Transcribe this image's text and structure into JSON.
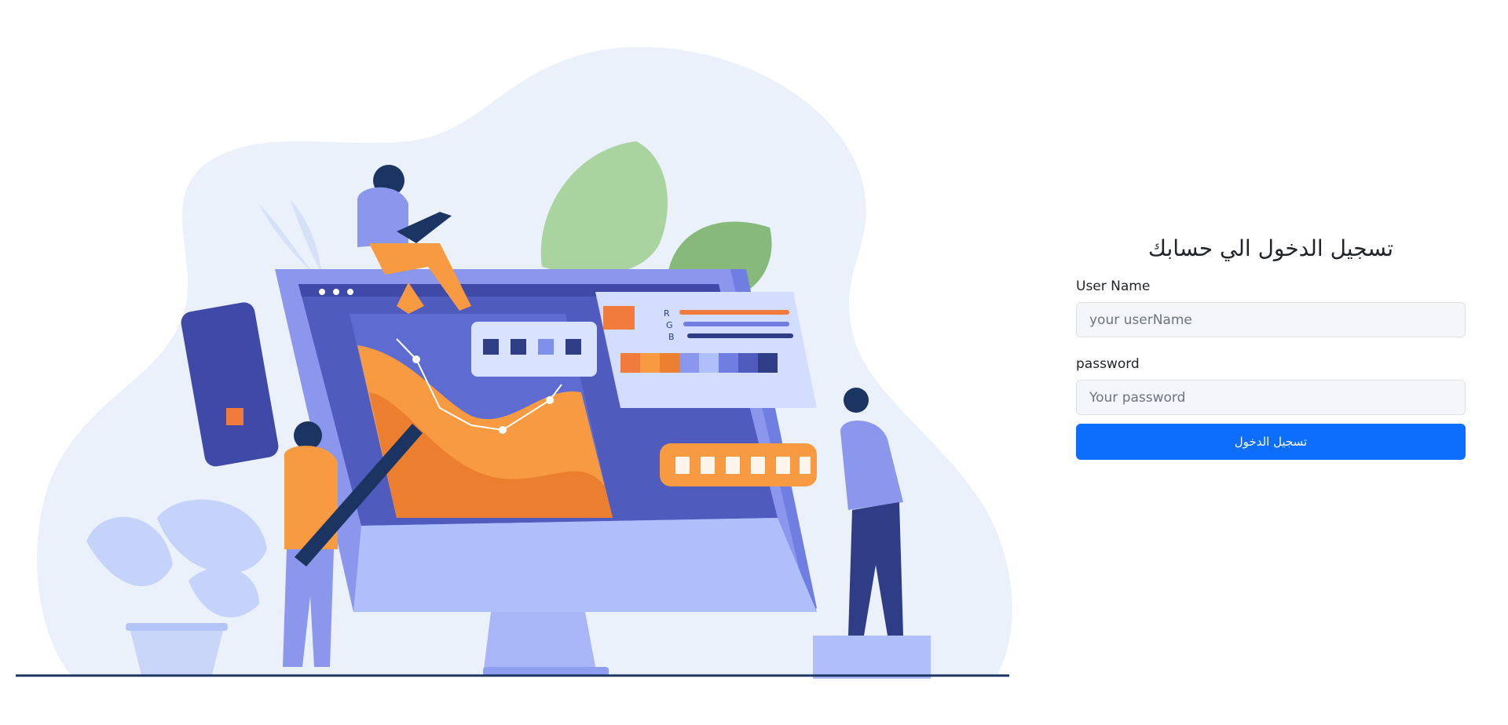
{
  "login": {
    "title": "تسجيل الدخول الي حسابك",
    "username_label": "User Name",
    "username_placeholder": "your userName",
    "password_label": "password",
    "password_placeholder": "Your password",
    "submit_label": "تسجيل الدخول"
  },
  "illustration": {
    "rgb_labels": [
      "R",
      "G",
      "B"
    ]
  },
  "colors": {
    "primary": "#0d6efd",
    "input_bg": "#f4f6f9",
    "blob_bg": "#eaf1fa",
    "accent_orange": "#f79a42",
    "monitor_blue": "#4f5bbd",
    "navy": "#1c3461"
  }
}
